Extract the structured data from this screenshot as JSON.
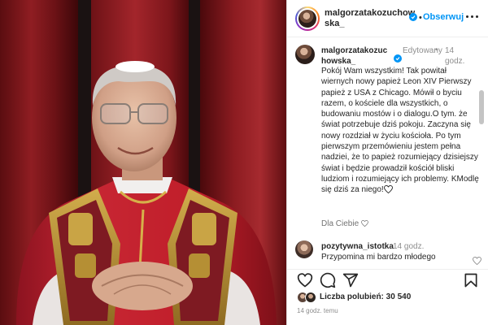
{
  "colors": {
    "link_blue": "#0095f6",
    "curtain_red": "#8f1d22",
    "vestment_red": "#c01e2a",
    "gold": "#b8902f"
  },
  "media": {
    "description_icon": "photo"
  },
  "header": {
    "username": "malgorzatakozuchowska_",
    "separator": "•",
    "follow_label": "Obserwuj",
    "more_icon": "more-horizontal-icon"
  },
  "caption": {
    "username": "malgorzatakozuchowska_",
    "edited_label": "Edytowany",
    "separator": "•",
    "time": "14 godz.",
    "text": "Pokój Wam wszystkim! Tak powitał wiernych nowy papież Leon XIV Pierwszy papież z USA z Chicago. Mówił o byciu razem, o kościele dla wszystkich, o budowaniu mostów i o dialogu.O tym. że świat potrzebuje dziś pokoju. Zaczyna się nowy rozdział w życiu kościoła. Po tym pierwszym przemówieniu jestem pełna nadziei, że to papież rozumiejący dzisiejszy świat i będzie prowadził kościół bliski ludziom i rozumiejący ich problemy. KModlę się dziś za niego!",
    "translate_label": "Dla Ciebie"
  },
  "comment": {
    "username": "pozytywna_istotka",
    "time": "14 godz.",
    "text": "Przypomina mi bardzo młodego"
  },
  "actions": {
    "icons": [
      "heart-icon",
      "comment-icon",
      "share-icon",
      "bookmark-icon"
    ],
    "likes_label": "Liczba polubień: 30 540",
    "posted": "14 godz. temu"
  }
}
